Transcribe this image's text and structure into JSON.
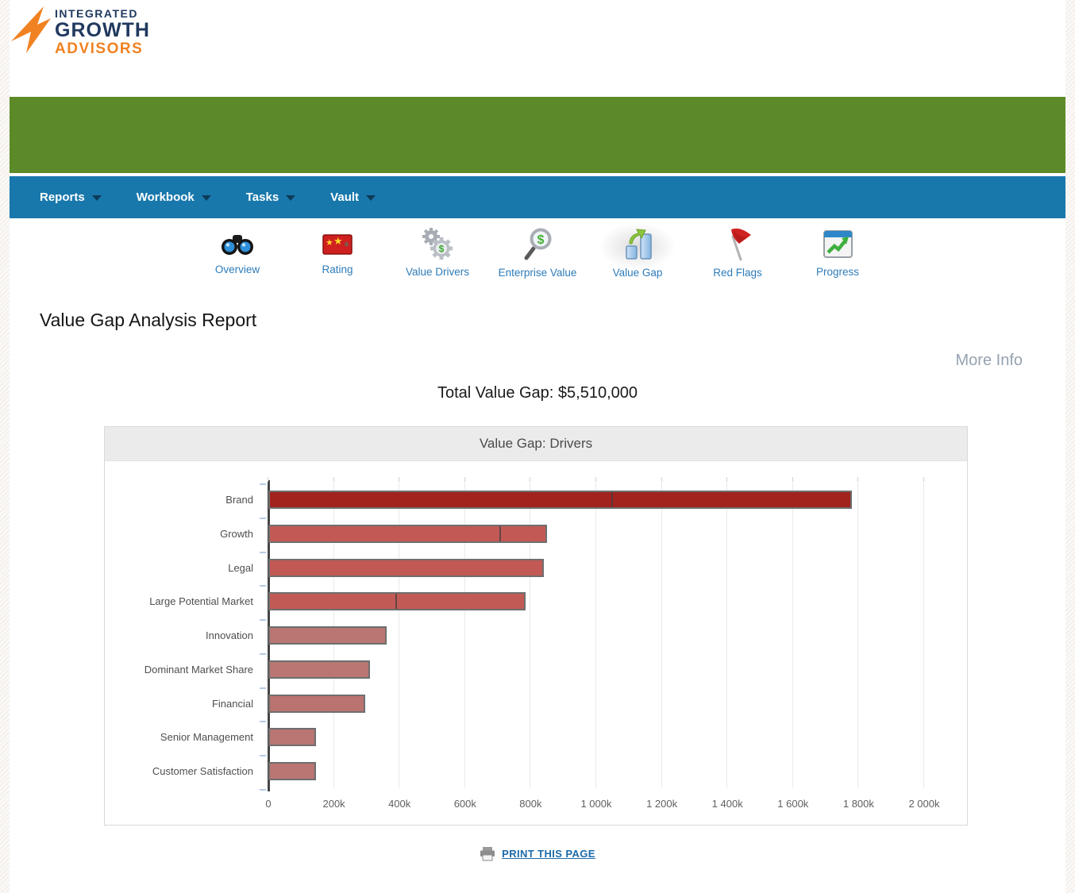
{
  "brand": {
    "line1": "INTEGRATED",
    "line2": "GROWTH",
    "line3": "ADVISORS"
  },
  "navbar": {
    "items": [
      {
        "label": "Reports"
      },
      {
        "label": "Workbook"
      },
      {
        "label": "Tasks"
      },
      {
        "label": "Vault"
      }
    ]
  },
  "toolbar": {
    "items": [
      {
        "label": "Overview",
        "icon": "binoculars-icon",
        "active": false
      },
      {
        "label": "Rating",
        "icon": "star-rating-icon",
        "active": false
      },
      {
        "label": "Value Drivers",
        "icon": "gears-dollar-icon",
        "active": false
      },
      {
        "label": "Enterprise Value",
        "icon": "magnifier-dollar-icon",
        "active": false
      },
      {
        "label": "Value Gap",
        "icon": "bar-chart-arrow-icon",
        "active": true
      },
      {
        "label": "Red Flags",
        "icon": "red-flag-icon",
        "active": false
      },
      {
        "label": "Progress",
        "icon": "progress-chart-icon",
        "active": false
      }
    ]
  },
  "page": {
    "title": "Value Gap Analysis Report",
    "more_info_label": "More Info",
    "total_value_gap": "Total Value Gap: $5,510,000"
  },
  "chart_data": {
    "type": "bar",
    "orientation": "horizontal",
    "title": "Value Gap: Drivers",
    "categories": [
      "Brand",
      "Growth",
      "Legal",
      "Large Potential Market",
      "Innovation",
      "Dominant Market Share",
      "Financial",
      "Senior Management",
      "Customer Satisfaction"
    ],
    "values": [
      1780000,
      850000,
      840000,
      785000,
      360000,
      310000,
      295000,
      145000,
      145000
    ],
    "segment_dividers": [
      1050000,
      710000,
      null,
      390000,
      null,
      null,
      null,
      null,
      null
    ],
    "bar_colors": [
      "#a2231d",
      "#c25955",
      "#c25955",
      "#c15a55",
      "#b97673",
      "#b97673",
      "#bb7370",
      "#b97673",
      "#b97673"
    ],
    "xlim": [
      0,
      2000000
    ],
    "x_tick_labels": [
      "0",
      "200k",
      "400k",
      "600k",
      "800k",
      "1 000k",
      "1 200k",
      "1 400k",
      "1 600k",
      "1 800k",
      "2 000k"
    ],
    "grid": true,
    "legend": false,
    "axis_color": "#454545",
    "gridline_color": "#e9e9e9"
  },
  "footer": {
    "print_label": "PRINT THIS PAGE"
  }
}
